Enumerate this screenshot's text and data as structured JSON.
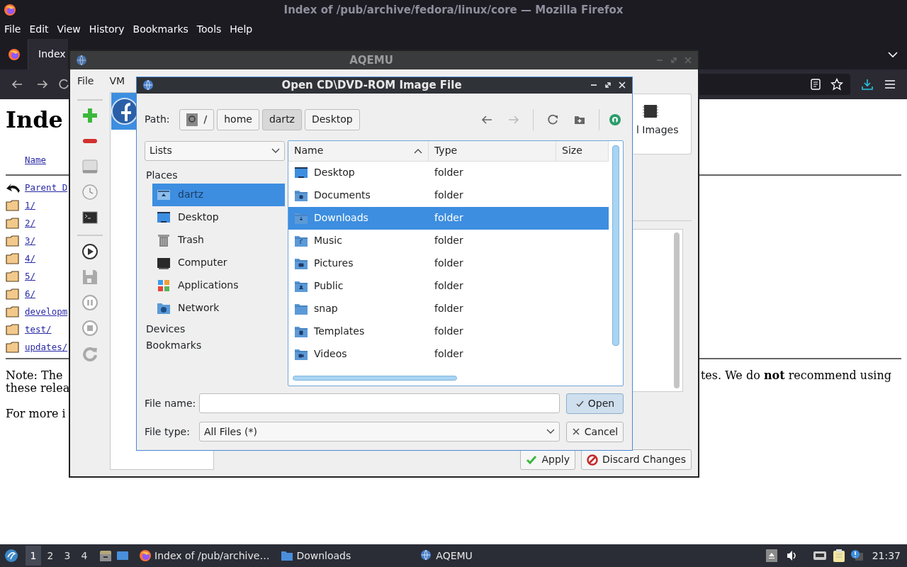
{
  "firefox": {
    "title": "Index of /pub/archive/fedora/linux/core — Mozilla Firefox",
    "menu": [
      "File",
      "Edit",
      "View",
      "History",
      "Bookmarks",
      "Tools",
      "Help"
    ],
    "tabs": [
      {
        "label": "Index",
        "selected": true
      }
    ],
    "page": {
      "heading": "Inde",
      "column": "Name",
      "entries": [
        {
          "name": "Parent D",
          "kind": "parent"
        },
        {
          "name": "1/",
          "kind": "folder"
        },
        {
          "name": "2/",
          "kind": "folder"
        },
        {
          "name": "3/",
          "kind": "folder"
        },
        {
          "name": "4/",
          "kind": "folder"
        },
        {
          "name": "5/",
          "kind": "folder"
        },
        {
          "name": "6/",
          "kind": "folder"
        },
        {
          "name": "developm",
          "kind": "folder"
        },
        {
          "name": "test/",
          "kind": "folder"
        },
        {
          "name": "updates/",
          "kind": "folder"
        }
      ],
      "note_left": [
        "Note: The",
        "these relea",
        "For more i"
      ],
      "note_right": "tes. We do **not** recommend using"
    }
  },
  "aqemu": {
    "title": "AQEMU",
    "menu": [
      "File",
      "VM"
    ],
    "card_label": "l Images",
    "buttons": [
      {
        "label": "Apply",
        "kind": "apply"
      },
      {
        "label": "Discard Changes",
        "kind": "discard"
      }
    ]
  },
  "dialog": {
    "title": "Open CD\\DVD-ROM Image File",
    "path_label": "Path:",
    "path": [
      {
        "label": "/",
        "kind": "root",
        "selected": false
      },
      {
        "label": "home",
        "kind": "dir",
        "selected": false
      },
      {
        "label": "dartz",
        "kind": "dir",
        "selected": true
      },
      {
        "label": "Desktop",
        "kind": "dir",
        "selected": false
      }
    ],
    "nav": [
      {
        "kind": "back",
        "disabled": false
      },
      {
        "kind": "forward",
        "disabled": true
      }
    ],
    "view_select": "Lists",
    "sections": [
      {
        "title": "Places",
        "items": [
          {
            "label": "dartz",
            "kind": "home",
            "selected": true
          },
          {
            "label": "Desktop",
            "kind": "desktop",
            "selected": false
          },
          {
            "label": "Trash",
            "kind": "trash",
            "selected": false
          },
          {
            "label": "Computer",
            "kind": "computer",
            "selected": false
          },
          {
            "label": "Applications",
            "kind": "apps",
            "selected": false
          },
          {
            "label": "Network",
            "kind": "network",
            "selected": false
          }
        ]
      },
      {
        "title": "Devices"
      },
      {
        "title": "Bookmarks"
      }
    ],
    "table": {
      "columns": [
        "Name",
        "Type",
        "Size"
      ],
      "rows": [
        {
          "name": "Desktop",
          "type": "folder",
          "kind": "desktop",
          "selected": false
        },
        {
          "name": "Documents",
          "type": "folder",
          "kind": "documents",
          "selected": false
        },
        {
          "name": "Downloads",
          "type": "folder",
          "kind": "downloads",
          "selected": true
        },
        {
          "name": "Music",
          "type": "folder",
          "kind": "music",
          "selected": false
        },
        {
          "name": "Pictures",
          "type": "folder",
          "kind": "pictures",
          "selected": false
        },
        {
          "name": "Public",
          "type": "folder",
          "kind": "public",
          "selected": false
        },
        {
          "name": "snap",
          "type": "folder",
          "kind": "plain",
          "selected": false
        },
        {
          "name": "Templates",
          "type": "folder",
          "kind": "templates",
          "selected": false
        },
        {
          "name": "Videos",
          "type": "folder",
          "kind": "videos",
          "selected": false
        }
      ]
    },
    "file_name_label": "File name:",
    "file_type": {
      "label": "File type:",
      "value": "All Files (*)"
    },
    "buttons": [
      {
        "label": "Open",
        "kind": "open"
      },
      {
        "label": "Cancel",
        "kind": "cancel"
      }
    ]
  },
  "taskbar": {
    "workspaces": [
      {
        "label": "1",
        "selected": true
      },
      {
        "label": "2",
        "selected": false
      },
      {
        "label": "3",
        "selected": false
      },
      {
        "label": "4",
        "selected": false
      }
    ],
    "tasks": [
      {
        "label": "Index of /pub/archive…",
        "kind": "browser"
      },
      {
        "label": "Downloads",
        "kind": "folder"
      },
      {
        "label": "AQEMU",
        "kind": "emulator"
      }
    ],
    "clock": "21:37"
  }
}
